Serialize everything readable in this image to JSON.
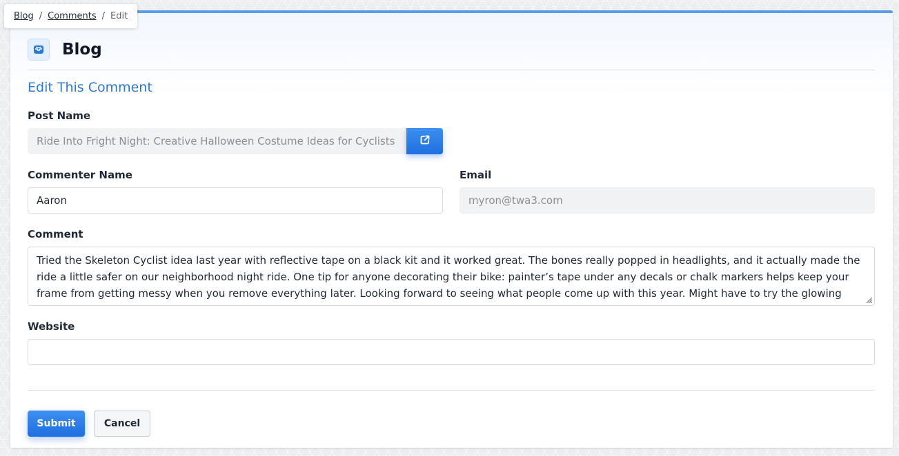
{
  "breadcrumb": {
    "items": [
      "Blog",
      "Comments"
    ],
    "current": "Edit",
    "separator": "/"
  },
  "header": {
    "title": "Blog",
    "icon": "mail-inbox-icon"
  },
  "form": {
    "section_title": "Edit This Comment",
    "post_name": {
      "label": "Post Name",
      "value": "Ride Into Fright Night: Creative Halloween Costume Ideas for Cyclists",
      "button_icon": "external-link-icon"
    },
    "commenter_name": {
      "label": "Commenter Name",
      "value": "Aaron"
    },
    "email": {
      "label": "Email",
      "value": "myron@twa3.com"
    },
    "comment": {
      "label": "Comment",
      "value": "Tried the Skeleton Cyclist idea last year with reflective tape on a black kit and it worked great. The bones really popped in headlights, and it actually made the ride a little safer on our neighborhood night ride. One tip for anyone decorating their bike: painter’s tape under any decals or chalk markers helps keep your frame from getting messy when you remove everything later. Looking forward to seeing what people come up with this year. Might have to try the glowing ghost next"
    },
    "website": {
      "label": "Website",
      "value": ""
    },
    "actions": {
      "submit_label": "Submit",
      "cancel_label": "Cancel"
    }
  },
  "colors": {
    "accent": "#2d7ad6",
    "primary_button": "#1f6fe0",
    "top_border": "#5b9be8"
  }
}
